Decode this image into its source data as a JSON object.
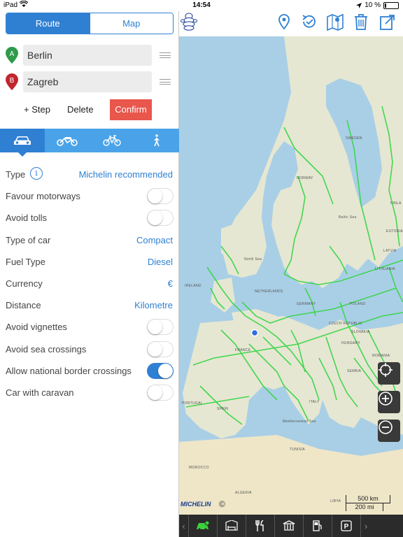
{
  "status": {
    "carrier": "iPad",
    "time": "14:54",
    "battery": "10 %",
    "battery_level": 0.1
  },
  "route_tabs": {
    "route": "Route",
    "map": "Map"
  },
  "waypoints": [
    {
      "letter": "A",
      "value": "Berlin",
      "color": "#2e9a4a"
    },
    {
      "letter": "B",
      "value": "Zagreb",
      "color": "#c0262d"
    }
  ],
  "actions": {
    "add_step": "+ Step",
    "delete": "Delete",
    "confirm": "Confirm"
  },
  "modes": [
    "car-icon",
    "motorbike-icon",
    "bicycle-icon",
    "pedestrian-icon"
  ],
  "options": [
    {
      "label": "Type",
      "value": "Michelin recommended",
      "kind": "value",
      "info": true
    },
    {
      "label": "Favour motorways",
      "kind": "toggle",
      "on": false
    },
    {
      "label": "Avoid tolls",
      "kind": "toggle",
      "on": false
    },
    {
      "label": "Type of car",
      "value": "Compact",
      "kind": "value"
    },
    {
      "label": "Fuel Type",
      "value": "Diesel",
      "kind": "value"
    },
    {
      "label": "Currency",
      "value": "€",
      "kind": "value"
    },
    {
      "label": "Distance",
      "value": "Kilometre",
      "kind": "value"
    },
    {
      "label": "Avoid vignettes",
      "kind": "toggle",
      "on": false
    },
    {
      "label": "Avoid sea crossings",
      "kind": "toggle",
      "on": false
    },
    {
      "label": "Allow national border crossings",
      "kind": "toggle",
      "on": true
    },
    {
      "label": "Car with caravan",
      "kind": "toggle",
      "on": false
    }
  ],
  "map": {
    "labels": [
      "SWEDEN",
      "NORWAY",
      "FINLA",
      "ESTONIA",
      "LATVIA",
      "LITHUANIA",
      "North Sea",
      "IRELAND",
      "NETHERLANDS",
      "GERMANY",
      "POLAND",
      "CZECH REPUBLIC",
      "SLOVAKIA",
      "HUNGARY",
      "ROMANIA",
      "SERBIA",
      "ITALY",
      "PORTUGAL",
      "SPAIN",
      "MOROCCO",
      "ALGERIA",
      "TUNISIA",
      "LIBYA",
      "Baltic Sea",
      "Mediterranean Sea",
      "FRANCE"
    ],
    "scale_km": "500 km",
    "scale_mi": "200 mi",
    "brand": "MICHELIN",
    "copyright": "©"
  },
  "poi_bar": [
    "car-service-icon",
    "hotel-icon",
    "restaurant-icon",
    "tourism-icon",
    "fuel-icon",
    "parking-icon"
  ]
}
